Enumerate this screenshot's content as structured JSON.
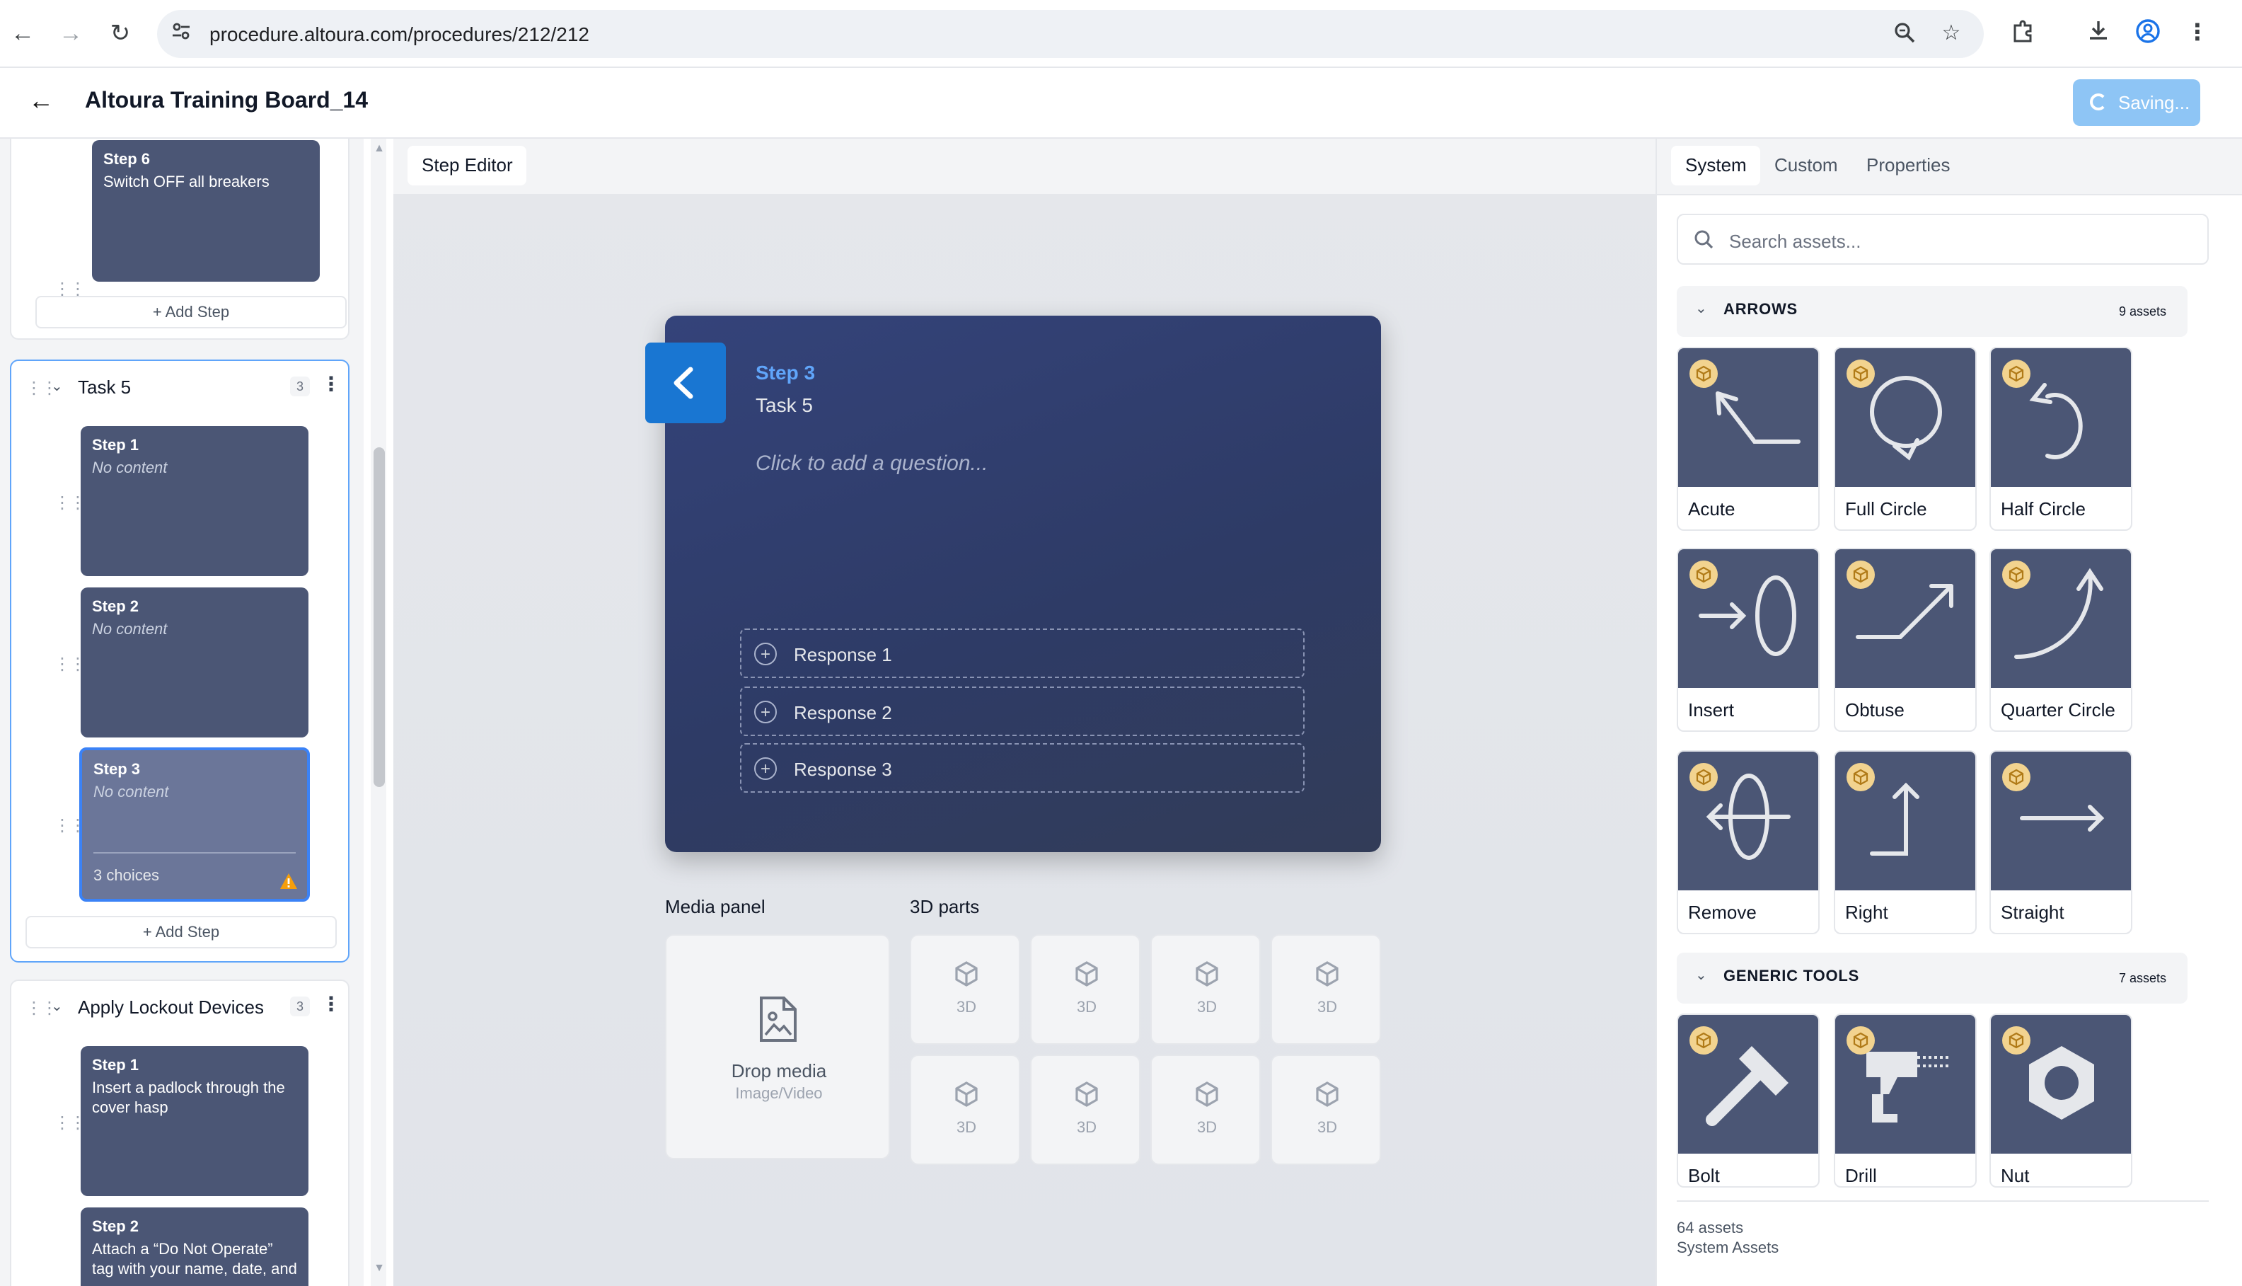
{
  "browser": {
    "url": "procedure.altoura.com/procedures/212/212"
  },
  "header": {
    "title": "Altoura Training Board_14",
    "saving_label": "Saving..."
  },
  "sidebar": {
    "prev_task": {
      "steps": [
        {
          "label": "Step 6",
          "description": "Switch OFF all breakers"
        }
      ],
      "add_step": "+ Add Step"
    },
    "task5": {
      "title": "Task 5",
      "count": "3",
      "steps": [
        {
          "label": "Step 1",
          "description": "No content"
        },
        {
          "label": "Step 2",
          "description": "No content"
        },
        {
          "label": "Step 3",
          "description": "No content",
          "choices": "3 choices"
        }
      ],
      "add_step": "+ Add Step"
    },
    "lockout": {
      "title": "Apply Lockout Devices",
      "count": "3",
      "steps": [
        {
          "label": "Step 1",
          "description": "Insert a padlock through the cover hasp"
        },
        {
          "label": "Step 2",
          "description": "Attach a “Do Not Operate” tag with your name, date, and"
        }
      ]
    }
  },
  "editor": {
    "tab": "Step Editor",
    "card": {
      "step": "Step 3",
      "task": "Task 5",
      "question_placeholder": "Click to add a question...",
      "responses": [
        "Response 1",
        "Response 2",
        "Response 3"
      ]
    },
    "media_panel": {
      "title": "Media panel",
      "drop_label": "Drop media",
      "drop_sub": "Image/Video"
    },
    "parts": {
      "title": "3D parts",
      "slots": [
        "3D",
        "3D",
        "3D",
        "3D",
        "3D",
        "3D",
        "3D",
        "3D"
      ]
    }
  },
  "assets_panel": {
    "tabs": [
      "System",
      "Custom",
      "Properties"
    ],
    "active_tab": "System",
    "search_placeholder": "Search assets...",
    "categories": [
      {
        "name": "ARROWS",
        "count": "9 assets",
        "items": [
          "Acute",
          "Full Circle",
          "Half Circle",
          "Insert",
          "Obtuse",
          "Quarter Circle",
          "Remove",
          "Right",
          "Straight"
        ]
      },
      {
        "name": "GENERIC TOOLS",
        "count": "7 assets",
        "items": [
          "Bolt",
          "Drill",
          "Nut"
        ]
      }
    ],
    "footer_count": "64 assets",
    "footer_source": "System Assets"
  },
  "colors": {
    "accent": "#1976d2",
    "card_bg": "#4b5675",
    "step_card_bg": "#34437a",
    "step_label": "#60a5fa",
    "warning": "#f59e0b",
    "asset_badge": "#f2d38f"
  }
}
